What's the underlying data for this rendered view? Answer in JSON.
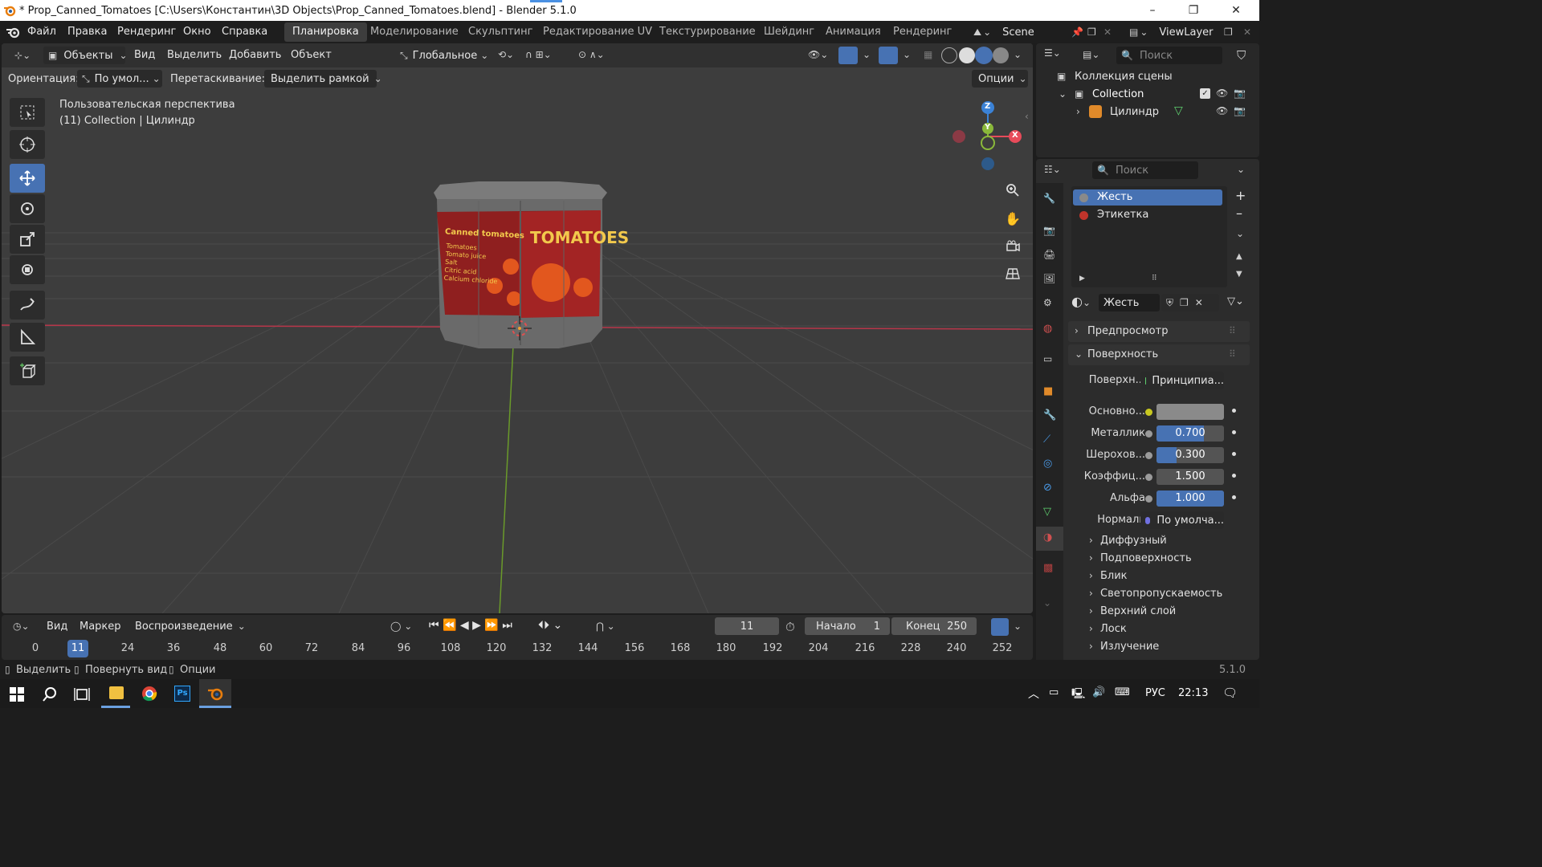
{
  "window": {
    "title": "* Prop_Canned_Tomatoes [C:\\Users\\Константин\\3D Objects\\Prop_Canned_Tomatoes.blend] - Blender 5.1.0",
    "minimize": "–",
    "maximize": "❐",
    "close": "✕"
  },
  "menu": [
    "Файл",
    "Правка",
    "Рендеринг",
    "Окно",
    "Справка"
  ],
  "workspaces": [
    "Планировка",
    "Моделирование",
    "Скульптинг",
    "Редактирование UV",
    "Текстурирование",
    "Шейдинг",
    "Анимация",
    "Рендеринг"
  ],
  "active_workspace": "Планировка",
  "scene": "Scene",
  "view_layer": "ViewLayer",
  "viewport_header": {
    "mode": "Объекты",
    "menus": [
      "Вид",
      "Выделить",
      "Добавить",
      "Объект"
    ],
    "transform_orientation": "Глобальное",
    "options": "Опции"
  },
  "tool_settings": {
    "orientation_label": "Ориентация:",
    "orientation_value": "По умол...",
    "drag_label": "Перетаскивание:",
    "drag_value": "Выделить рамкой"
  },
  "viewport": {
    "view_name": "Пользовательская перспектива",
    "object_info": "(11) Collection | Цилиндр",
    "can_label_left": "Canned tomatoes",
    "can_ingredients": [
      "Tomatoes",
      "Tomato juice",
      "Salt",
      "Citric acid",
      "Calcium chloride"
    ],
    "can_label_right": "TOMATOES"
  },
  "gizmo": {
    "z": "Z",
    "y": "Y",
    "x": "X"
  },
  "outliner": {
    "search_placeholder": "Поиск",
    "root": "Коллекция сцены",
    "collection": "Collection",
    "object": "Цилиндр"
  },
  "properties": {
    "search_placeholder": "Поиск",
    "materials": [
      {
        "name": "Жесть",
        "color": "#8a8a8a"
      },
      {
        "name": "Этикетка",
        "color": "#c0342b"
      }
    ],
    "material_name": "Жесть",
    "panels": {
      "preview": "Предпросмотр",
      "surface": "Поверхность"
    },
    "surface_label": "Поверхн...",
    "surface_value": "Принципиа...",
    "base_color_label": "Основно...",
    "metallic_label": "Металлик",
    "metallic_value": "0.700",
    "metallic": 0.7,
    "roughness_label": "Шерохов...",
    "roughness_value": "0.300",
    "roughness": 0.3,
    "ior_label": "Коэффиц...",
    "ior_value": "1.500",
    "alpha_label": "Альфа",
    "alpha_value": "1.000",
    "alpha": 1.0,
    "normal_label": "Нормаль",
    "normal_value": "По умолча...",
    "subsections": [
      "Диффузный",
      "Подповерхность",
      "Блик",
      "Светопропускаемость",
      "Верхний слой",
      "Лоск",
      "Излучение"
    ]
  },
  "timeline": {
    "menus": [
      "Вид",
      "Маркер",
      "Воспроизведение"
    ],
    "current_frame": "11",
    "start_label": "Начало",
    "start": "1",
    "end_label": "Конец",
    "end": "250",
    "ticks": [
      "0",
      "11",
      "24",
      "36",
      "48",
      "60",
      "72",
      "84",
      "96",
      "108",
      "120",
      "132",
      "144",
      "156",
      "168",
      "180",
      "192",
      "204",
      "216",
      "228",
      "240",
      "252"
    ]
  },
  "statusbar": {
    "select": "Выделить",
    "rotate": "Повернуть вид",
    "options": "Опции",
    "version": "5.1.0"
  },
  "taskbar": {
    "lang": "РУС",
    "time": "22:13"
  },
  "colors": {
    "accent": "#4772b3",
    "x_axis": "#e84b5a",
    "y_axis": "#8ab83a",
    "z_axis": "#3b82d6"
  }
}
